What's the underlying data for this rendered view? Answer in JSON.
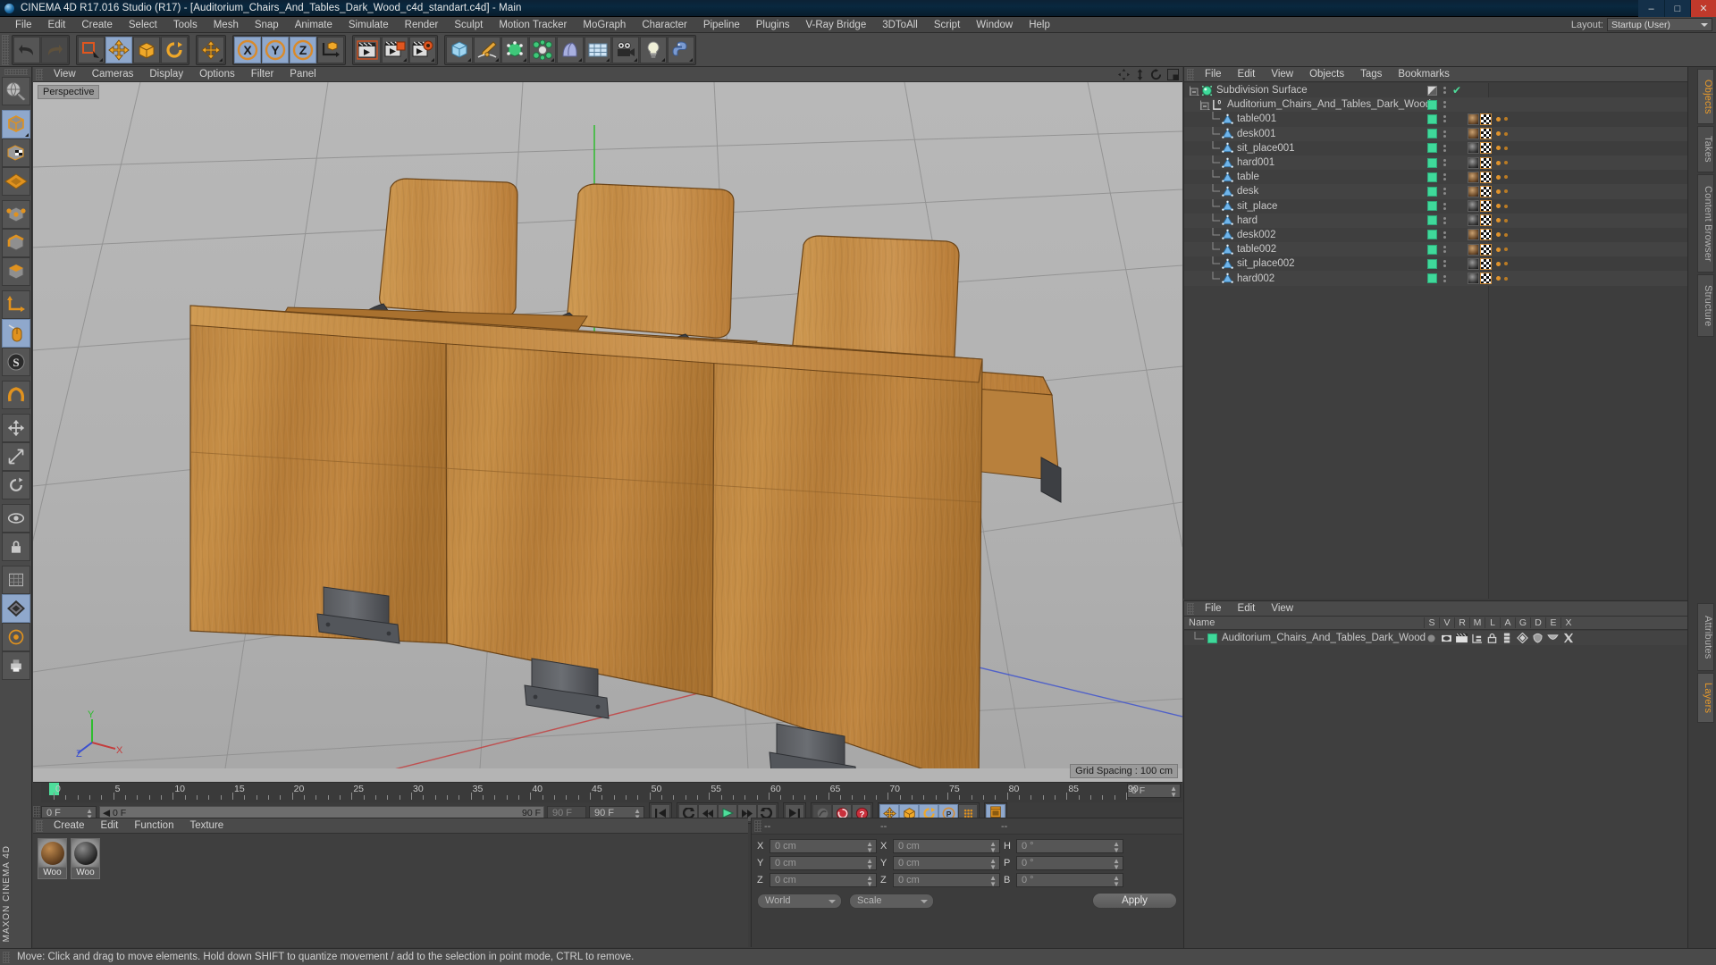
{
  "window": {
    "title": "CINEMA 4D R17.016 Studio (R17) - [Auditorium_Chairs_And_Tables_Dark_Wood_c4d_standart.c4d] - Main",
    "minimize": "–",
    "maximize": "□",
    "close": "✕"
  },
  "menubar": {
    "items": [
      "File",
      "Edit",
      "Create",
      "Select",
      "Tools",
      "Mesh",
      "Snap",
      "Animate",
      "Simulate",
      "Render",
      "Sculpt",
      "Motion Tracker",
      "MoGraph",
      "Character",
      "Pipeline",
      "Plugins",
      "V-Ray Bridge",
      "3DToAll",
      "Script",
      "Window",
      "Help"
    ],
    "layout_label": "Layout:",
    "layout_value": "Startup (User)"
  },
  "viewport": {
    "menu": [
      "View",
      "Cameras",
      "Display",
      "Options",
      "Filter",
      "Panel"
    ],
    "perspective_tag": "Perspective",
    "grid_spacing": "Grid Spacing : 100 cm",
    "axis": {
      "y": "Y",
      "x": "X",
      "z": "Z"
    }
  },
  "timeline": {
    "ticks": [
      {
        "label": "0",
        "value": 0
      },
      {
        "label": "5",
        "value": 5
      },
      {
        "label": "10",
        "value": 10
      },
      {
        "label": "15",
        "value": 15
      },
      {
        "label": "20",
        "value": 20
      },
      {
        "label": "25",
        "value": 25
      },
      {
        "label": "30",
        "value": 30
      },
      {
        "label": "35",
        "value": 35
      },
      {
        "label": "40",
        "value": 40
      },
      {
        "label": "45",
        "value": 45
      },
      {
        "label": "50",
        "value": 50
      },
      {
        "label": "55",
        "value": 55
      },
      {
        "label": "60",
        "value": 60
      },
      {
        "label": "65",
        "value": 65
      },
      {
        "label": "70",
        "value": 70
      },
      {
        "label": "75",
        "value": 75
      },
      {
        "label": "80",
        "value": 80
      },
      {
        "label": "85",
        "value": 85
      },
      {
        "label": "90",
        "value": 90
      }
    ],
    "current_frame_right": "0 F",
    "current_frame_left": "0 F",
    "range_start": "0 F",
    "range_end": "90 F",
    "max_frame_small": "90 F",
    "max_frame_field": "90 F"
  },
  "materials": {
    "menu": [
      "Create",
      "Edit",
      "Function",
      "Texture"
    ],
    "items": [
      {
        "label": "Woo",
        "color_a": "#c08a4e",
        "color_b": "#5b3a1c"
      },
      {
        "label": "Woo",
        "color_a": "#8a8a8a",
        "color_b": "#202020"
      }
    ]
  },
  "coordinates": {
    "headers": [
      "--",
      "--",
      "--"
    ],
    "rows": [
      {
        "pos_label": "X",
        "pos_value": "0 cm",
        "size_label": "X",
        "size_value": "0 cm",
        "rot_label": "H",
        "rot_value": "0 °"
      },
      {
        "pos_label": "Y",
        "pos_value": "0 cm",
        "size_label": "Y",
        "size_value": "0 cm",
        "rot_label": "P",
        "rot_value": "0 °"
      },
      {
        "pos_label": "Z",
        "pos_value": "0 cm",
        "size_label": "Z",
        "size_value": "0 cm",
        "rot_label": "B",
        "rot_value": "0 °"
      }
    ],
    "space_select": "World",
    "mode_select": "Scale",
    "apply_label": "Apply"
  },
  "object_manager": {
    "menu": [
      "File",
      "Edit",
      "View",
      "Objects",
      "Tags",
      "Bookmarks"
    ],
    "items": [
      {
        "name": "Subdivision Surface",
        "indent": 0,
        "type": "generator",
        "enabled_icon": "checkerboard",
        "has_check": true,
        "tags": []
      },
      {
        "name": "Auditorium_Chairs_And_Tables_Dark_Wood",
        "indent": 1,
        "type": "null",
        "enabled_icon": "green",
        "has_check": false,
        "tags": []
      },
      {
        "name": "table001",
        "indent": 2,
        "type": "polygon",
        "enabled_icon": "green",
        "has_check": false,
        "tags": [
          "mat-wood",
          "uv"
        ]
      },
      {
        "name": "desk001",
        "indent": 2,
        "type": "polygon",
        "enabled_icon": "green",
        "has_check": false,
        "tags": [
          "mat-wood",
          "uv"
        ]
      },
      {
        "name": "sit_place001",
        "indent": 2,
        "type": "polygon",
        "enabled_icon": "green",
        "has_check": false,
        "tags": [
          "mat-dark",
          "uv"
        ]
      },
      {
        "name": "hard001",
        "indent": 2,
        "type": "polygon",
        "enabled_icon": "green",
        "has_check": false,
        "tags": [
          "mat-dark",
          "uv"
        ]
      },
      {
        "name": "table",
        "indent": 2,
        "type": "polygon",
        "enabled_icon": "green",
        "has_check": false,
        "tags": [
          "mat-wood",
          "uv"
        ]
      },
      {
        "name": "desk",
        "indent": 2,
        "type": "polygon",
        "enabled_icon": "green",
        "has_check": false,
        "tags": [
          "mat-wood",
          "uv"
        ]
      },
      {
        "name": "sit_place",
        "indent": 2,
        "type": "polygon",
        "enabled_icon": "green",
        "has_check": false,
        "tags": [
          "mat-dark",
          "uv"
        ]
      },
      {
        "name": "hard",
        "indent": 2,
        "type": "polygon",
        "enabled_icon": "green",
        "has_check": false,
        "tags": [
          "mat-dark",
          "uv"
        ]
      },
      {
        "name": "desk002",
        "indent": 2,
        "type": "polygon",
        "enabled_icon": "green",
        "has_check": false,
        "tags": [
          "mat-wood",
          "uv"
        ]
      },
      {
        "name": "table002",
        "indent": 2,
        "type": "polygon",
        "enabled_icon": "green",
        "has_check": false,
        "tags": [
          "mat-wood",
          "uv"
        ]
      },
      {
        "name": "sit_place002",
        "indent": 2,
        "type": "polygon",
        "enabled_icon": "green",
        "has_check": false,
        "tags": [
          "mat-dark",
          "uv"
        ]
      },
      {
        "name": "hard002",
        "indent": 2,
        "type": "polygon",
        "enabled_icon": "green",
        "has_check": false,
        "tags": [
          "mat-dark",
          "uv"
        ]
      }
    ]
  },
  "layer_manager": {
    "menu": [
      "File",
      "Edit",
      "View"
    ],
    "name_header": "Name",
    "columns": [
      "S",
      "V",
      "R",
      "M",
      "L",
      "A",
      "G",
      "D",
      "E",
      "X"
    ],
    "rows": [
      {
        "name": "Auditorium_Chairs_And_Tables_Dark_Wood",
        "color": "#3fd99a"
      }
    ]
  },
  "right_tabs": {
    "top": [
      "Objects",
      "Takes",
      "Content Browser",
      "Structure"
    ],
    "bottom": [
      "Attributes",
      "Layers"
    ],
    "active_top": "Objects",
    "active_bottom": "Layers"
  },
  "statusbar": {
    "message": "Move: Click and drag to move elements. Hold down SHIFT to quantize movement / add to the selection in point mode, CTRL to remove."
  },
  "colors": {
    "accent_orange": "#e8941f",
    "active_blue": "#8fa8cc",
    "green_enable": "#3fd99a",
    "panel_bg": "#3c3c3c",
    "viewport_bg": "#b4b4b4",
    "wood": "#c07f3a"
  }
}
